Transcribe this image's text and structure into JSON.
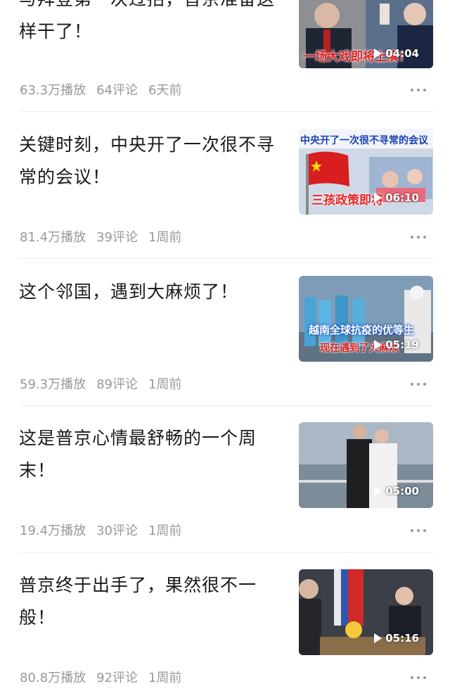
{
  "feed": [
    {
      "title": "与拜登第一次过招，普京准备这样干了！",
      "duration": "04:04",
      "thumb_caption": "一场大戏即将上演！",
      "plays": "63.3万播放",
      "comments": "64评论",
      "time": "6天前"
    },
    {
      "title": "关键时刻，中央开了一次很不寻常的会议！",
      "duration": "06:10",
      "thumb_caption": "中央开了一次很不寻常的会议",
      "thumb_caption2": "三孩政策即将",
      "plays": "81.4万播放",
      "comments": "39评论",
      "time": "1周前"
    },
    {
      "title": "这个邻国，遇到大麻烦了！",
      "duration": "05:19",
      "thumb_caption": "越南全球抗疫的优等生",
      "thumb_caption2": "现在遇到了大麻烦",
      "plays": "59.3万播放",
      "comments": "89评论",
      "time": "1周前"
    },
    {
      "title": "这是普京心情最舒畅的一个周末！",
      "duration": "05:00",
      "plays": "19.4万播放",
      "comments": "30评论",
      "time": "1周前"
    },
    {
      "title": "普京终于出手了，果然很不一般！",
      "duration": "05:16",
      "plays": "80.8万播放",
      "comments": "92评论",
      "time": "1周前"
    }
  ]
}
